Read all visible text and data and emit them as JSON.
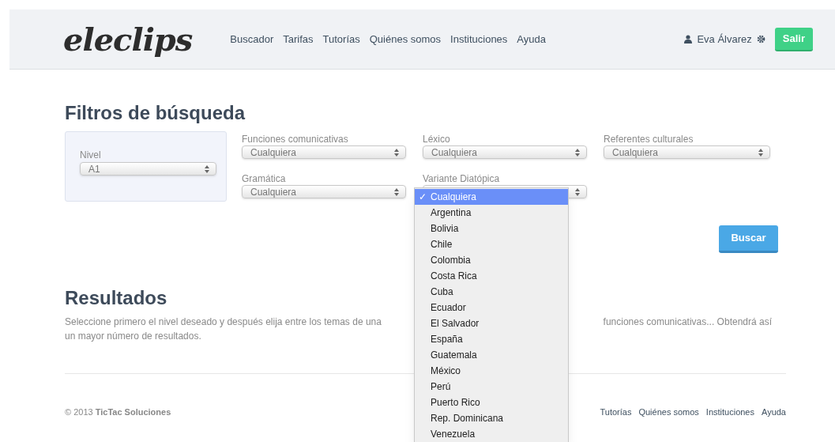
{
  "header": {
    "logo": "eleclips",
    "nav": [
      "Buscador",
      "Tarifas",
      "Tutorías",
      "Quiénes somos",
      "Instituciones",
      "Ayuda"
    ],
    "user": "Eva Álvarez",
    "logout": "Salir"
  },
  "filters": {
    "title": "Filtros de búsqueda",
    "level": {
      "label": "Nivel",
      "value": "A1"
    },
    "selects": [
      {
        "label": "Funciones comunicativas",
        "value": "Cualquiera"
      },
      {
        "label": "Léxico",
        "value": "Cualquiera"
      },
      {
        "label": "Referentes culturales",
        "value": "Cualquiera"
      },
      {
        "label": "Gramática",
        "value": "Cualquiera"
      },
      {
        "label": "Variante Diatópica",
        "open": true
      }
    ],
    "dropdown": [
      {
        "label": "Cualquiera",
        "selected": true
      },
      {
        "label": "Argentina",
        "selected": false
      },
      {
        "label": "Bolivia",
        "selected": false
      },
      {
        "label": "Chile",
        "selected": false
      },
      {
        "label": "Colombia",
        "selected": false
      },
      {
        "label": "Costa Rica",
        "selected": false
      },
      {
        "label": "Cuba",
        "selected": false
      },
      {
        "label": "Ecuador",
        "selected": false
      },
      {
        "label": "El Salvador",
        "selected": false
      },
      {
        "label": "España",
        "selected": false
      },
      {
        "label": "Guatemala",
        "selected": false
      },
      {
        "label": "México",
        "selected": false
      },
      {
        "label": "Perú",
        "selected": false
      },
      {
        "label": "Puerto Rico",
        "selected": false
      },
      {
        "label": "Rep. Dominicana",
        "selected": false
      },
      {
        "label": "Venezuela",
        "selected": false
      }
    ],
    "check": "✓",
    "search_button": "Buscar"
  },
  "results": {
    "title": "Resultados",
    "text_left": "Seleccione primero el nivel deseado y después elija entre los temas de una",
    "text_right": "funciones comunicativas... Obtendrá así",
    "text_line2": "un mayor número de resultados."
  },
  "footer": {
    "copyright": "© 2013 **TicTac Soluciones**",
    "links": [
      "Tutorías",
      "Quiénes somos",
      "Instituciones",
      "Ayuda"
    ]
  }
}
